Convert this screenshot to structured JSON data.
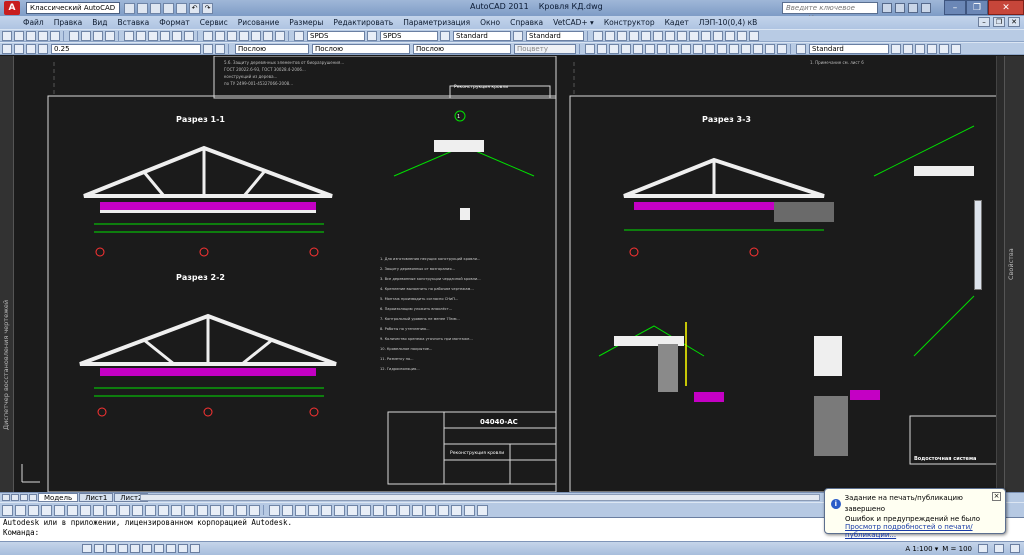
{
  "app": {
    "workspace": "Классический AutoCAD",
    "title": "AutoCAD 2011",
    "file": "Кровля КД.dwg",
    "help_placeholder": "Введите ключевое слово/фразу"
  },
  "menu": [
    "Файл",
    "Правка",
    "Вид",
    "Вставка",
    "Формат",
    "Сервис",
    "Рисование",
    "Размеры",
    "Редактировать",
    "Параметризация",
    "Окно",
    "Справка",
    "VetCAD+ ▾",
    "Конструктор",
    "Кадет",
    "ЛЭП-10(0,4) кВ"
  ],
  "toolbar": {
    "layer": "0.25",
    "color": "Послою",
    "linetype": "Послою",
    "lineweight": "Послою",
    "plotstyle": "Поцвету",
    "text_style": "SPDS",
    "dim_style": "SPDS",
    "table_style": "Standard",
    "mleader_style": "Standard",
    "style5": "Standard"
  },
  "drawing": {
    "sections": [
      "Разрез 1-1",
      "Разрез 2-2",
      "Разрез 3-3"
    ],
    "stamp_code": "04040-АС",
    "stamp_title": "Реконструкция кровли",
    "right_title": "Водосточная система",
    "circle_label": "1"
  },
  "tabs": [
    "Модель",
    "Лист1",
    "Лист2"
  ],
  "command": {
    "history": "Autodesk или в приложении, лицензированном корпорацией Autodesk.",
    "prompt": "Команда:"
  },
  "status": {
    "coords": "",
    "scale": "A 1:100 ▾",
    "zoom": "M = 100"
  },
  "balloon": {
    "title": "Задание на печать/публикацию завершено",
    "line2": "Ошибок и предупреждений не было",
    "link": "Просмотр подробностей о печати/публикации..."
  },
  "side": {
    "left": "Диспетчер восстановления чертежей",
    "right": "Свойства"
  },
  "colors": {
    "background": "#1b1b1b",
    "structure": "#efefef",
    "dimensions": "#00e000",
    "axes": "#ff3333",
    "insulation": "#ff00ff",
    "highlight": "#ffff00"
  }
}
